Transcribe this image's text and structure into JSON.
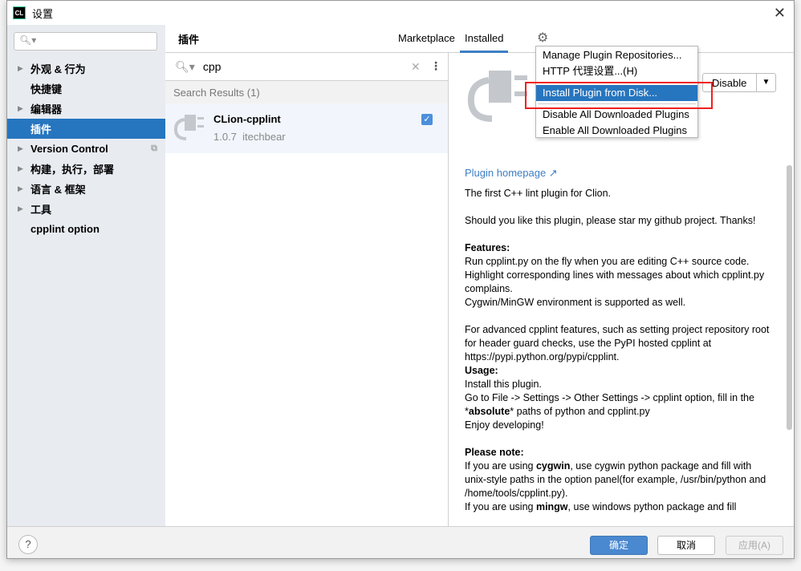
{
  "window": {
    "title": "设置",
    "logo": "CL"
  },
  "sidebar": {
    "search_placeholder": "",
    "items": [
      {
        "label": "外观 & 行为",
        "expandable": true
      },
      {
        "label": "快捷键",
        "expandable": false
      },
      {
        "label": "编辑器",
        "expandable": true
      },
      {
        "label": "插件",
        "expandable": false,
        "selected": true
      },
      {
        "label": "Version Control",
        "expandable": true
      },
      {
        "label": "构建，执行，部署",
        "expandable": true
      },
      {
        "label": "语言 & 框架",
        "expandable": true
      },
      {
        "label": "工具",
        "expandable": true
      },
      {
        "label": "cpplint option",
        "expandable": false
      }
    ]
  },
  "header": {
    "title": "插件",
    "tabs": [
      {
        "label": "Marketplace"
      },
      {
        "label": "Installed",
        "active": true
      }
    ],
    "gear_icon": "gear-icon"
  },
  "search": {
    "value": "cpp"
  },
  "results": {
    "header": "Search Results (1)",
    "items": [
      {
        "name": "CLion-cpplint",
        "version": "1.0.7",
        "vendor": "itechbear",
        "enabled": true
      }
    ]
  },
  "menu": {
    "items": [
      "Manage Plugin Repositories...",
      "HTTP 代理设置...(H)",
      "Install Plugin from Disk...",
      "Disable All Downloaded Plugins",
      "Enable All Downloaded Plugins"
    ],
    "selected": "Install Plugin from Disk..."
  },
  "detail": {
    "disable_label": "Disable",
    "homepage": "Plugin homepage ↗",
    "l1": "The first C++ lint plugin for Clion.",
    "l2": "Should you like this plugin, please star my github project. Thanks!",
    "features": "Features:",
    "f1": "Run cpplint.py on the fly when you are editing C++ source code.",
    "f2": "Highlight corresponding lines with messages about which cpplint.py complains.",
    "f3": "Cygwin/MinGW environment is supported as well.",
    "adv": "For advanced cpplint features, such as setting project repository root for header guard checks, use the PyPI hosted cpplint at https://pypi.python.org/pypi/cpplint.",
    "usage": "Usage:",
    "u1": "Install this plugin.",
    "u2a": "Go to File -> Settings -> Other Settings -> cpplint option, fill in the *",
    "u2b": "absolute",
    "u2c": "* paths of python and cpplint.py",
    "u3": "Enjoy developing!",
    "note": "Please note:",
    "n1a": "If you are using ",
    "n1b": "cygwin",
    "n1c": ", use cygwin python package and fill with unix-style paths in the option panel(for example, /usr/bin/python and /home/tools/cpplint.py).",
    "n2a": "If you are using ",
    "n2b": "mingw",
    "n2c": ", use windows python package and fill"
  },
  "footer": {
    "help": "?",
    "ok": "确定",
    "cancel": "取消",
    "apply": "应用(A)"
  },
  "colors": {
    "accent": "#2675bf",
    "highlight_box": "#f02020"
  }
}
